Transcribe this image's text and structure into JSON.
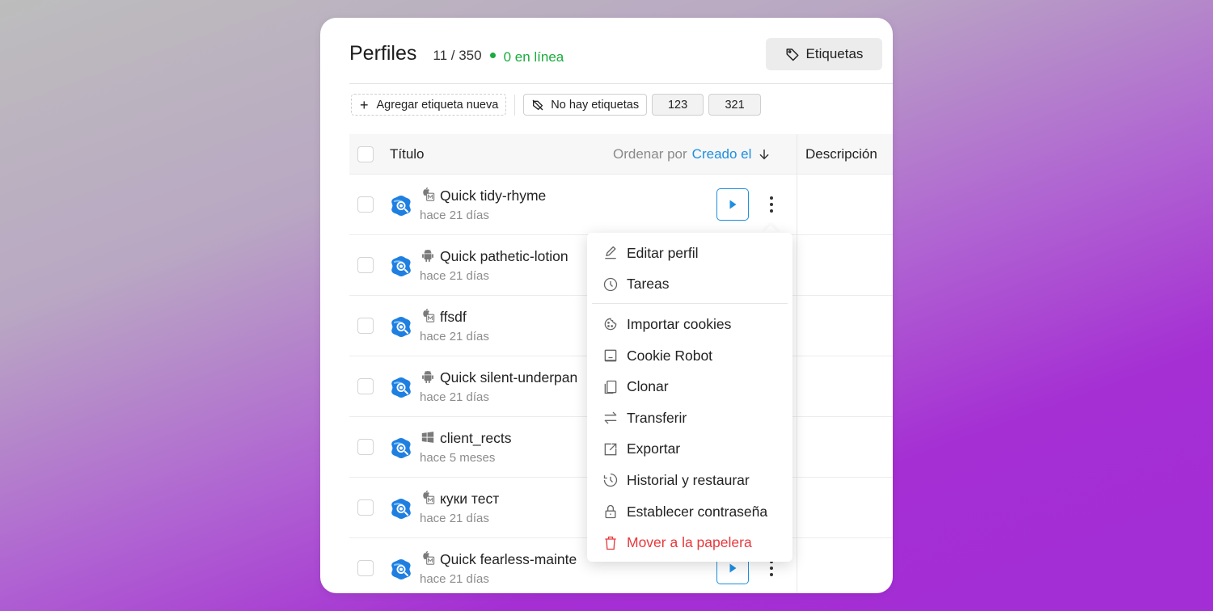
{
  "header": {
    "title": "Perfiles",
    "count": "11 / 350",
    "online": "0 en línea",
    "tags_button": "Etiquetas"
  },
  "tagbar": {
    "add_tag": "Agregar etiqueta nueva",
    "no_tags": "No hay etiquetas",
    "tags": [
      "123",
      "321"
    ]
  },
  "table": {
    "col_title": "Título",
    "sort_label": "Ordenar por",
    "sort_value": "Creado el",
    "col_description": "Descripción",
    "rows": [
      {
        "name": "Quick tidy-rhyme",
        "time": "hace 21 días",
        "os": "macos-icon"
      },
      {
        "name": "Quick pathetic-lotion",
        "time": "hace 21 días",
        "os": "android-icon"
      },
      {
        "name": "ffsdf",
        "time": "hace 21 días",
        "os": "macos-icon"
      },
      {
        "name": "Quick silent-underpan",
        "time": "hace 21 días",
        "os": "android-icon"
      },
      {
        "name": "client_rects",
        "time": "hace 5 meses",
        "os": "windows-icon"
      },
      {
        "name": "куки тест",
        "time": "hace 21 días",
        "os": "macos-icon"
      },
      {
        "name": "Quick fearless-mainte",
        "time": "hace 21 días",
        "os": "macos-icon"
      }
    ]
  },
  "menu": {
    "items": [
      {
        "label": "Editar perfil",
        "icon": "edit-icon"
      },
      {
        "label": "Tareas",
        "icon": "clock-icon"
      },
      {
        "label": "Importar cookies",
        "icon": "cookie-icon"
      },
      {
        "label": "Cookie Robot",
        "icon": "robot-icon"
      },
      {
        "label": "Clonar",
        "icon": "clone-icon"
      },
      {
        "label": "Transferir",
        "icon": "transfer-icon"
      },
      {
        "label": "Exportar",
        "icon": "export-icon"
      },
      {
        "label": "Historial y restaurar",
        "icon": "history-icon"
      },
      {
        "label": "Establecer contraseña",
        "icon": "lock-icon"
      },
      {
        "label": "Mover a la papelera",
        "icon": "trash-icon"
      }
    ]
  },
  "colors": {
    "accent": "#1e8fe0",
    "online": "#1aab3e",
    "danger": "#e6393d"
  }
}
